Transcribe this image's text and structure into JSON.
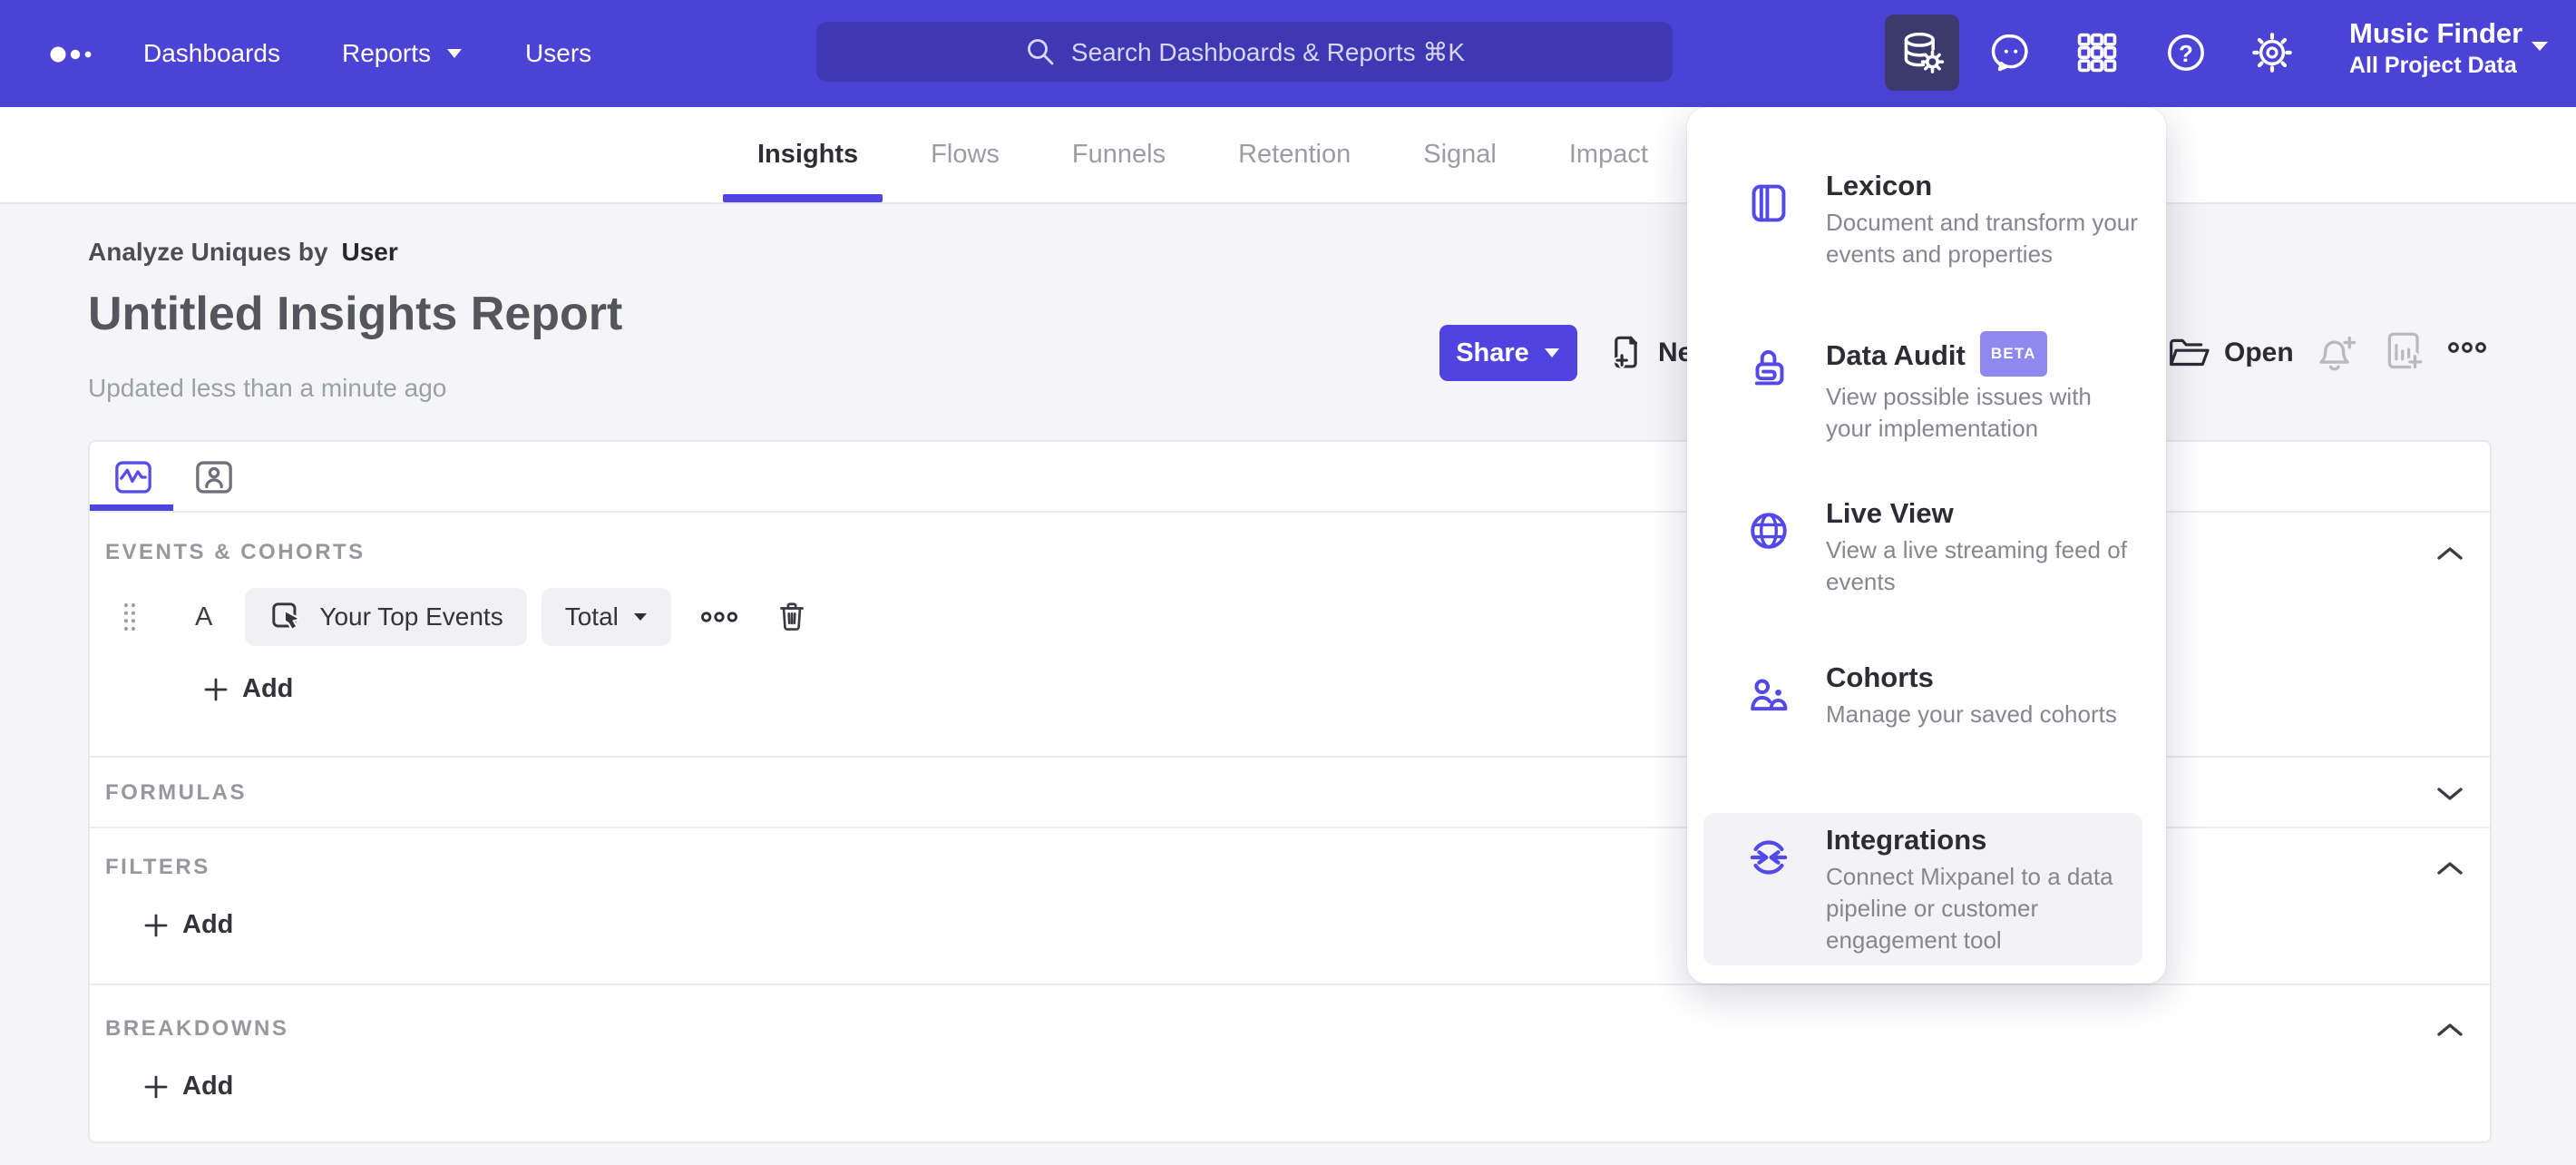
{
  "colors": {
    "nav_background": "#4b43d6",
    "nav_active_icon_background": "#3a3a6c",
    "accent_purple": "#5044e0",
    "beta_badge_background": "#8f88ee",
    "menu_highlight_background": "#f3f3f5",
    "page_background": "#f5f5f7"
  },
  "topnav": {
    "dashboards": "Dashboards",
    "reports": "Reports",
    "users": "Users",
    "search_placeholder": "Search Dashboards & Reports ⌘K",
    "project_name": "Music Finder",
    "project_scope": "All Project Data"
  },
  "tabs": {
    "items": [
      "Insights",
      "Flows",
      "Funnels",
      "Retention",
      "Signal",
      "Impact"
    ],
    "active": "Insights"
  },
  "report_header": {
    "breadcrumb_prefix": "Analyze Uniques by",
    "breadcrumb_value": "User",
    "title": "Untitled Insights Report",
    "updated": "Updated less than a minute ago",
    "share_label": "Share",
    "new_label": "New",
    "open_label": "Open"
  },
  "builder": {
    "events_section_label": "EVENTS & COHORTS",
    "event_row": {
      "letter": "A",
      "event_name": "Your Top Events",
      "aggregation": "Total"
    },
    "events_add_label": "Add",
    "formulas_section_label": "FORMULAS",
    "filters_section_label": "FILTERS",
    "filters_add_label": "Add",
    "breakdowns_section_label": "BREAKDOWNS",
    "breakdowns_add_label": "Add"
  },
  "dropdown": {
    "items": [
      {
        "title": "Lexicon",
        "description": "Document and transform your events and properties"
      },
      {
        "title": "Data Audit",
        "badge": "BETA",
        "description": "View possible issues with your implementation"
      },
      {
        "title": "Live View",
        "description": "View a live streaming feed of events"
      },
      {
        "title": "Cohorts",
        "description": "Manage your saved cohorts"
      },
      {
        "title": "Integrations",
        "description": "Connect Mixpanel to a data pipeline or customer engagement tool"
      }
    ]
  }
}
